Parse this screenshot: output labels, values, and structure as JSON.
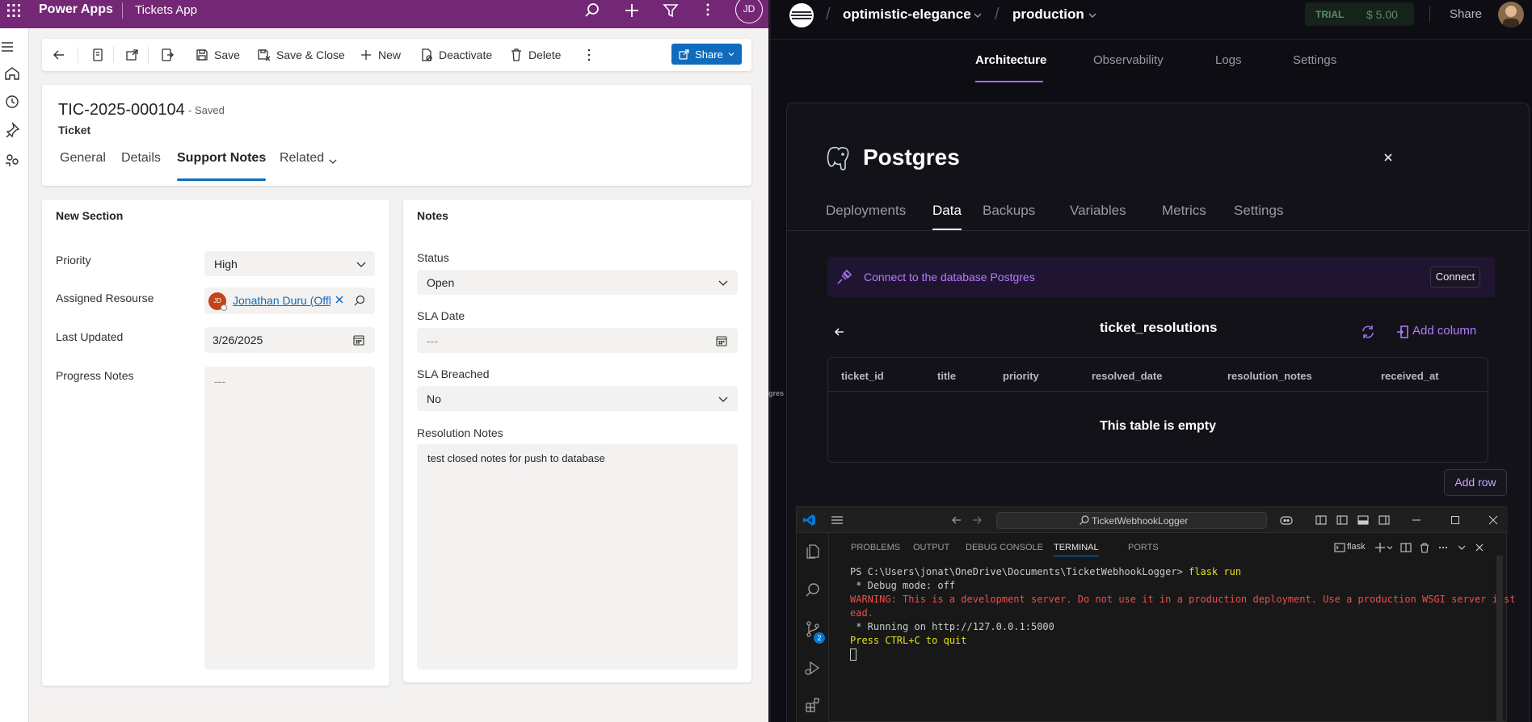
{
  "powerapps": {
    "brand": "Power Apps",
    "app_name": "Tickets App",
    "user_initials": "JD",
    "commands": {
      "save": "Save",
      "save_close": "Save & Close",
      "new": "New",
      "deactivate": "Deactivate",
      "delete": "Delete",
      "share": "Share"
    },
    "record": {
      "title": "TIC-2025-000104",
      "saved_status": "- Saved",
      "entity": "Ticket"
    },
    "tabs": [
      "General",
      "Details",
      "Support Notes",
      "Related"
    ],
    "new_section": {
      "title": "New Section",
      "priority_label": "Priority",
      "priority_value": "High",
      "assigned_label": "Assigned Resourse",
      "assigned_initials": "JD",
      "assigned_value": "Jonathan Duru (Offli",
      "last_updated_label": "Last Updated",
      "last_updated_value": "3/26/2025",
      "progress_label": "Progress Notes",
      "progress_value": "---"
    },
    "notes_section": {
      "title": "Notes",
      "status_label": "Status",
      "status_value": "Open",
      "sla_date_label": "SLA Date",
      "sla_date_value": "---",
      "sla_breached_label": "SLA Breached",
      "sla_breached_value": "No",
      "resolution_label": "Resolution Notes",
      "resolution_value": "test closed notes for push to database"
    }
  },
  "railway": {
    "project": "optimistic-elegance",
    "environment": "production",
    "trial_label": "TRIAL",
    "trial_amount": "$ 5.00",
    "share": "Share",
    "nav": [
      "Architecture",
      "Observability",
      "Logs",
      "Settings"
    ],
    "service_name": "Postgres",
    "service_tabs": [
      "Deployments",
      "Data",
      "Backups",
      "Variables",
      "Metrics",
      "Settings"
    ],
    "connect_text": "Connect to the database Postgres",
    "connect_button": "Connect",
    "table_name": "ticket_resolutions",
    "add_column": "Add column",
    "columns": [
      "ticket_id",
      "title",
      "priority",
      "resolved_date",
      "resolution_notes",
      "received_at"
    ],
    "empty_text": "This table is empty",
    "add_row": "Add row",
    "bg_fragment": "gres"
  },
  "vscode": {
    "search_text": "TicketWebhookLogger",
    "panel_tabs": [
      "PROBLEMS",
      "OUTPUT",
      "DEBUG CONSOLE",
      "TERMINAL",
      "PORTS"
    ],
    "terminal_name": "flask",
    "scm_badge": "2",
    "terminal": {
      "prompt": "PS C:\\Users\\jonat\\OneDrive\\Documents\\TicketWebhookLogger> ",
      "command": "flask run",
      "line1": " * Debug mode: off",
      "warn1": "WARNING: This is a development server. Do not use it in a production deployment. Use a production WSGI server inst",
      "warn2": "ead.",
      "line3": " * Running on http://127.0.0.1:5000",
      "line4": "Press CTRL+C to quit"
    }
  },
  "colors": {
    "powerapps_purple": "#742774",
    "share_blue": "#0f6cbd",
    "railway_accent": "#a36cf2",
    "terminal_warning": "#f14c4c",
    "terminal_yellow": "#e5e510"
  }
}
